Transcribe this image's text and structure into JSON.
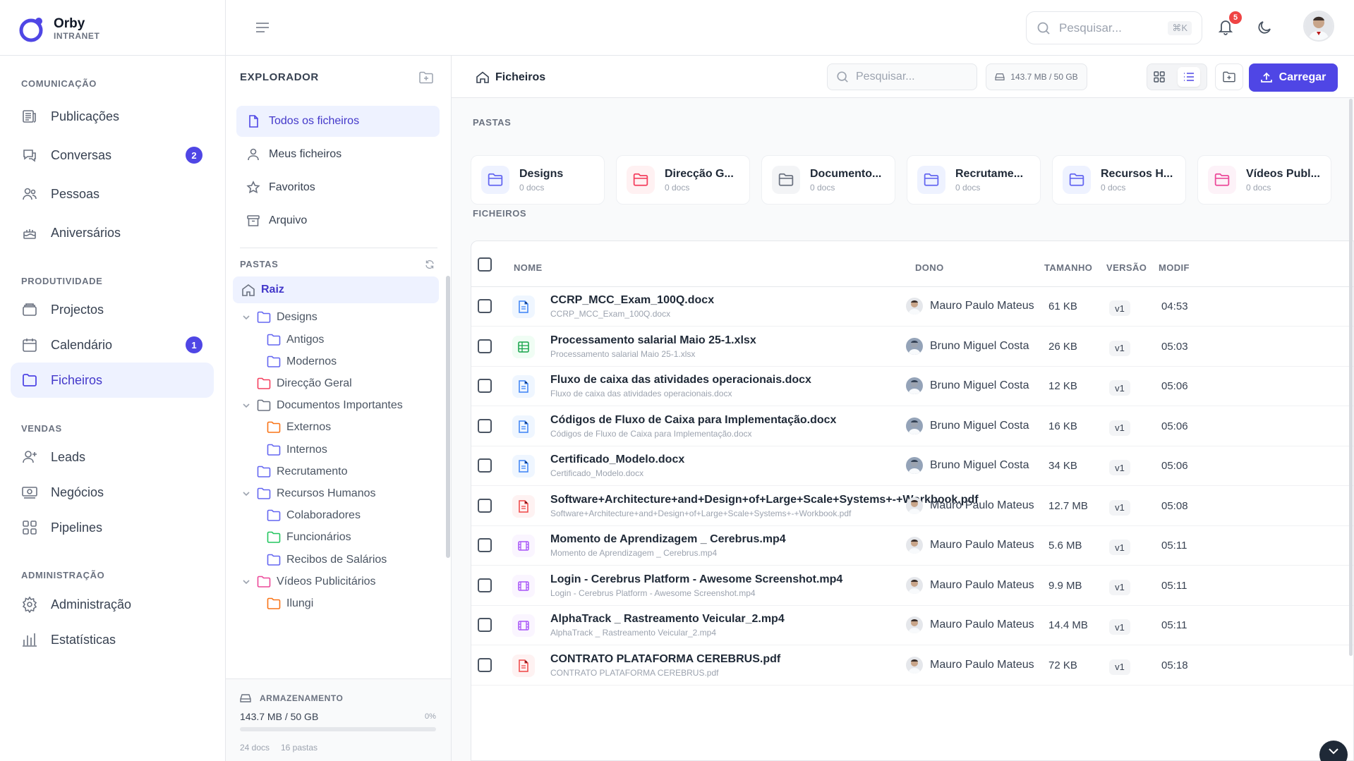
{
  "brand": {
    "name": "Orby",
    "subtitle": "INTRANET"
  },
  "nav": {
    "sections": [
      {
        "label": "COMUNICAÇÃO"
      },
      {
        "label": "PRODUTIVIDADE"
      },
      {
        "label": "VENDAS"
      },
      {
        "label": "ADMINISTRAÇÃO"
      }
    ],
    "items": [
      {
        "label": "Publicações",
        "icon": "newspaper-icon"
      },
      {
        "label": "Conversas",
        "icon": "chat-icon",
        "badge": "2"
      },
      {
        "label": "Pessoas",
        "icon": "users-icon"
      },
      {
        "label": "Aniversários",
        "icon": "cake-icon"
      },
      {
        "label": "Projectos",
        "icon": "folder-stack-icon"
      },
      {
        "label": "Calendário",
        "icon": "calendar-icon",
        "badge": "1"
      },
      {
        "label": "Ficheiros",
        "icon": "folder-icon",
        "active": true
      },
      {
        "label": "Leads",
        "icon": "user-plus-icon"
      },
      {
        "label": "Negócios",
        "icon": "money-icon"
      },
      {
        "label": "Pipelines",
        "icon": "grid-icon"
      },
      {
        "label": "Administração",
        "icon": "gear-icon"
      },
      {
        "label": "Estatísticas",
        "icon": "bar-chart-icon"
      }
    ]
  },
  "topbar": {
    "search_placeholder": "Pesquisar...",
    "shortcut": "⌘K",
    "notification_count": "5"
  },
  "explorer": {
    "title": "EXPLORADOR",
    "items": [
      {
        "label": "Todos os ficheiros",
        "active": true
      },
      {
        "label": "Meus ficheiros"
      },
      {
        "label": "Favoritos"
      },
      {
        "label": "Arquivo"
      }
    ],
    "folders_label": "PASTAS",
    "tree": [
      {
        "label": "Raiz",
        "color": "#6b7280",
        "active": true
      },
      {
        "label": "Designs",
        "color": "#6366f1",
        "expanded": true
      },
      {
        "label": "Antigos",
        "color": "#6366f1"
      },
      {
        "label": "Modernos",
        "color": "#6366f1"
      },
      {
        "label": "Direcção Geral",
        "color": "#f43f5e"
      },
      {
        "label": "Documentos Importantes",
        "color": "#6b7280",
        "expanded": true
      },
      {
        "label": "Externos",
        "color": "#f97316"
      },
      {
        "label": "Internos",
        "color": "#6366f1"
      },
      {
        "label": "Recrutamento",
        "color": "#6366f1"
      },
      {
        "label": "Recursos Humanos",
        "color": "#6366f1",
        "expanded": true
      },
      {
        "label": "Colaboradores",
        "color": "#6366f1"
      },
      {
        "label": "Funcionários",
        "color": "#22c55e"
      },
      {
        "label": "Recibos de Salários",
        "color": "#6366f1"
      },
      {
        "label": "Vídeos Publicitários",
        "color": "#ec4899",
        "expanded": true
      },
      {
        "label": "Ilungi",
        "color": "#f97316"
      }
    ],
    "storage": {
      "label": "ARMAZENAMENTO",
      "used": "143.7 MB / 50 GB",
      "percent_text": "0%",
      "percent": 0,
      "docs": "24 docs",
      "folders": "16 pastas"
    }
  },
  "content": {
    "breadcrumb": "Ficheiros",
    "search_placeholder": "Pesquisar...",
    "storage_chip": "143.7 MB / 50 GB",
    "upload_label": "Carregar",
    "folders_label": "PASTAS",
    "files_label": "FICHEIROS",
    "folders": [
      {
        "name": "Designs",
        "docs": "0 docs",
        "color": "#6366f1",
        "bg": "#eef2ff"
      },
      {
        "name": "Direcção G...",
        "docs": "0 docs",
        "color": "#f43f5e",
        "bg": "#fff1f2"
      },
      {
        "name": "Documento...",
        "docs": "0 docs",
        "color": "#6b7280",
        "bg": "#f3f4f6"
      },
      {
        "name": "Recrutame...",
        "docs": "0 docs",
        "color": "#6366f1",
        "bg": "#eef2ff"
      },
      {
        "name": "Recursos H...",
        "docs": "0 docs",
        "color": "#6366f1",
        "bg": "#eef2ff"
      },
      {
        "name": "Vídeos Publ...",
        "docs": "0 docs",
        "color": "#ec4899",
        "bg": "#fdf2f8"
      }
    ],
    "table": {
      "headers": {
        "name": "NOME",
        "owner": "DONO",
        "size": "TAMANHO",
        "version": "VERSÃO",
        "modified": "MODIF"
      },
      "rows": [
        {
          "name": "CCRP_MCC_Exam_100Q.docx",
          "sub": "CCRP_MCC_Exam_100Q.docx",
          "type": "doc",
          "owner": "Mauro Paulo Mateus",
          "size": "61 KB",
          "version": "v1",
          "modified": "04:53"
        },
        {
          "name": "Processamento salarial Maio 25-1.xlsx",
          "sub": "Processamento salarial Maio 25-1.xlsx",
          "type": "sheet",
          "owner": "Bruno Miguel Costa",
          "size": "26 KB",
          "version": "v1",
          "modified": "05:03"
        },
        {
          "name": "Fluxo de caixa das atividades operacionais.docx",
          "sub": "Fluxo de caixa das atividades operacionais.docx",
          "type": "doc",
          "owner": "Bruno Miguel Costa",
          "size": "12 KB",
          "version": "v1",
          "modified": "05:06"
        },
        {
          "name": "Códigos de Fluxo de Caixa para Implementação.docx",
          "sub": "Códigos de Fluxo de Caixa para Implementação.docx",
          "type": "doc",
          "owner": "Bruno Miguel Costa",
          "size": "16 KB",
          "version": "v1",
          "modified": "05:06"
        },
        {
          "name": "Certificado_Modelo.docx",
          "sub": "Certificado_Modelo.docx",
          "type": "doc",
          "owner": "Bruno Miguel Costa",
          "size": "34 KB",
          "version": "v1",
          "modified": "05:06"
        },
        {
          "name": "Software+Architecture+and+Design+of+Large+Scale+Systems+-+Workbook.pdf",
          "sub": "Software+Architecture+and+Design+of+Large+Scale+Systems+-+Workbook.pdf",
          "type": "pdf",
          "owner": "Mauro Paulo Mateus",
          "size": "12.7 MB",
          "version": "v1",
          "modified": "05:08"
        },
        {
          "name": "Momento de Aprendizagem _ Cerebrus.mp4",
          "sub": "Momento de Aprendizagem _ Cerebrus.mp4",
          "type": "video",
          "owner": "Mauro Paulo Mateus",
          "size": "5.6 MB",
          "version": "v1",
          "modified": "05:11"
        },
        {
          "name": "Login - Cerebrus Platform - Awesome Screenshot.mp4",
          "sub": "Login - Cerebrus Platform - Awesome Screenshot.mp4",
          "type": "video",
          "owner": "Mauro Paulo Mateus",
          "size": "9.9 MB",
          "version": "v1",
          "modified": "05:11"
        },
        {
          "name": "AlphaTrack _ Rastreamento Veicular_2.mp4",
          "sub": "AlphaTrack _ Rastreamento Veicular_2.mp4",
          "type": "video",
          "owner": "Mauro Paulo Mateus",
          "size": "14.4 MB",
          "version": "v1",
          "modified": "05:11"
        },
        {
          "name": "CONTRATO PLATAFORMA CEREBRUS.pdf",
          "sub": "CONTRATO PLATAFORMA CEREBRUS.pdf",
          "type": "pdf",
          "owner": "Mauro Paulo Mateus",
          "size": "72 KB",
          "version": "v1",
          "modified": "05:18"
        }
      ]
    }
  },
  "colors": {
    "accent": "#4f46e5",
    "danger": "#ef4444"
  }
}
